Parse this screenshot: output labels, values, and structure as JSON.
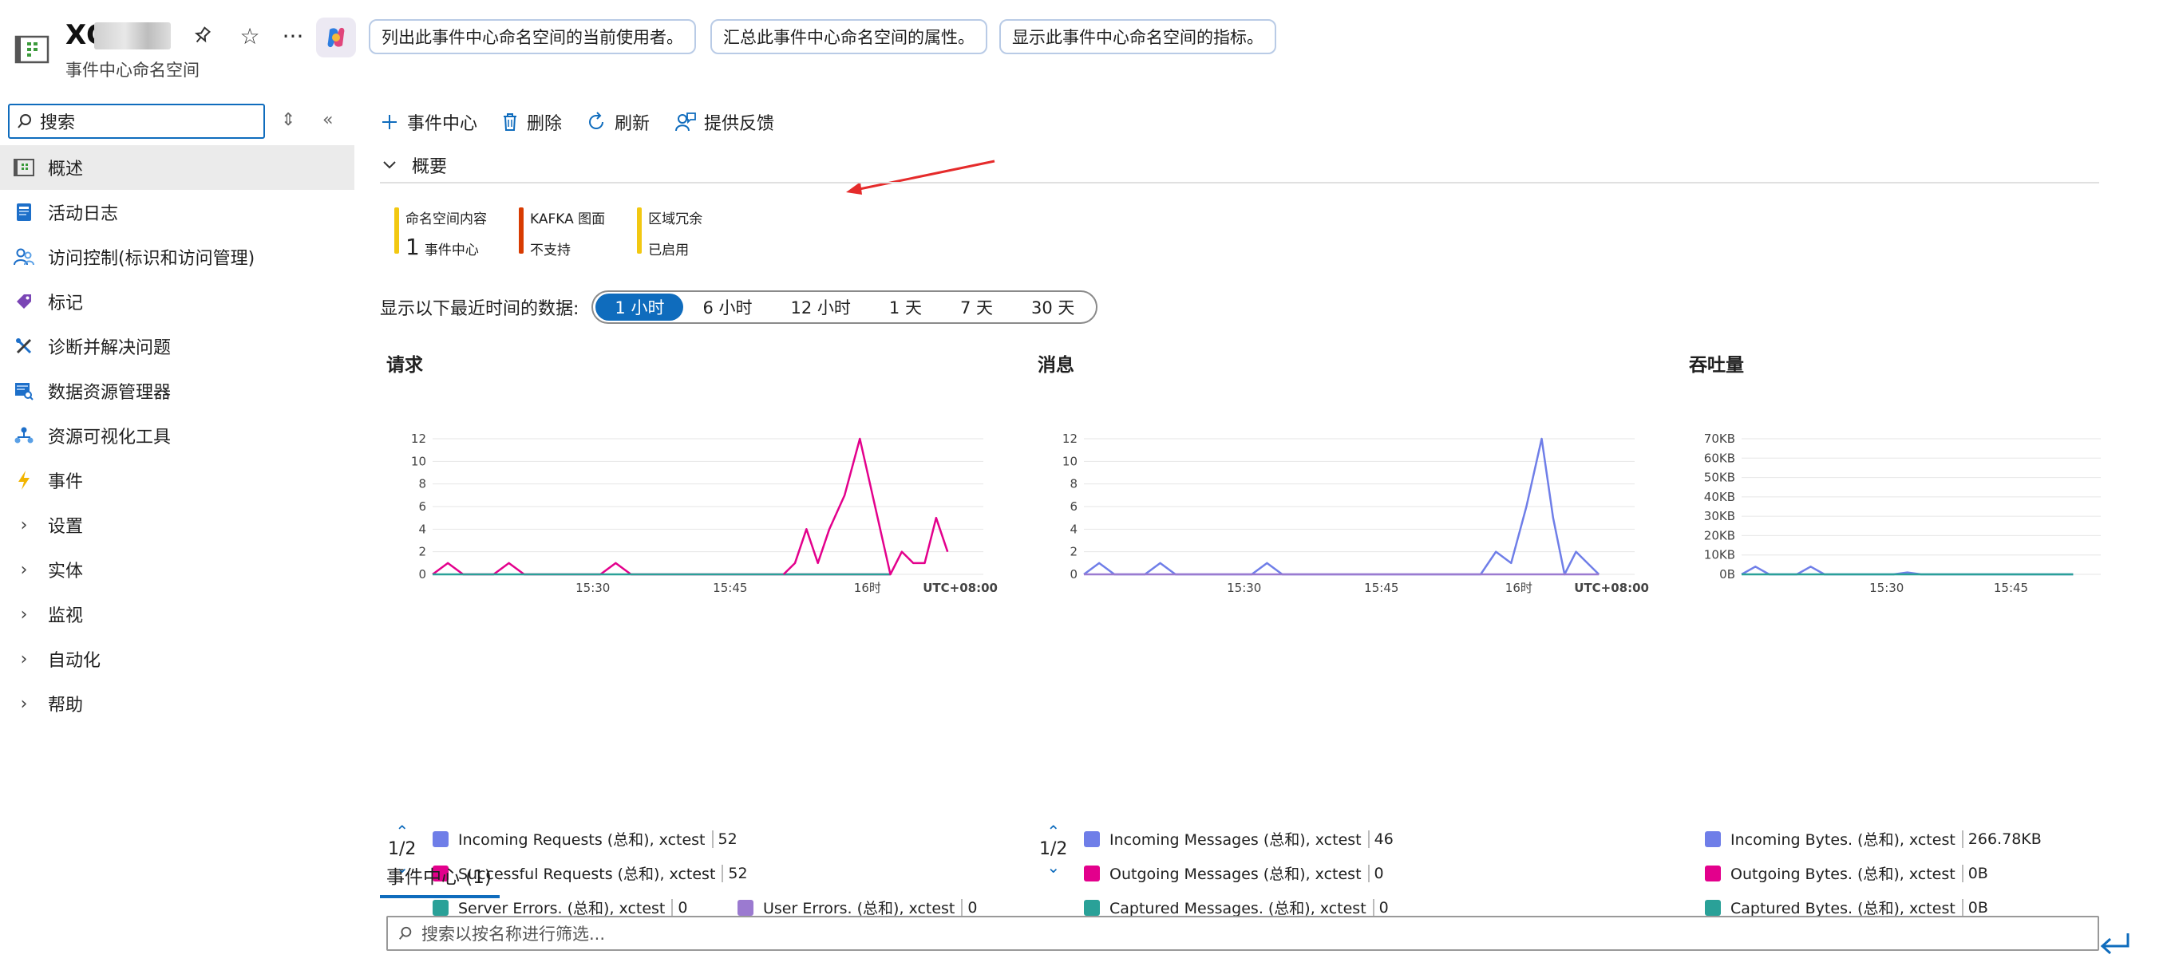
{
  "header": {
    "title": "XC",
    "subtitle": "事件中心命名空间",
    "chips": [
      "列出此事件中心命名空间的当前使用者。",
      "汇总此事件中心命名空间的属性。",
      "显示此事件中心命名空间的指标。"
    ],
    "icons": [
      "pin-icon",
      "star-icon",
      "more-icon",
      "copilot-icon"
    ]
  },
  "sidebar": {
    "search_placeholder": "搜索",
    "items": [
      {
        "label": "概述",
        "icon": "overview-icon",
        "active": true
      },
      {
        "label": "活动日志",
        "icon": "activity-log-icon"
      },
      {
        "label": "访问控制(标识和访问管理)",
        "icon": "people-icon"
      },
      {
        "label": "标记",
        "icon": "tag-icon"
      },
      {
        "label": "诊断并解决问题",
        "icon": "wrench-icon"
      },
      {
        "label": "数据资源管理器",
        "icon": "data-explorer-icon"
      },
      {
        "label": "资源可视化工具",
        "icon": "visualizer-icon"
      },
      {
        "label": "事件",
        "icon": "lightning-icon"
      },
      {
        "label": "设置",
        "expandable": true
      },
      {
        "label": "实体",
        "expandable": true
      },
      {
        "label": "监视",
        "expandable": true
      },
      {
        "label": "自动化",
        "expandable": true
      },
      {
        "label": "帮助",
        "expandable": true
      }
    ]
  },
  "toolbar": {
    "add_event_hub": "事件中心",
    "delete": "删除",
    "refresh": "刷新",
    "feedback": "提供反馈"
  },
  "essentials": {
    "title": "概要",
    "cards": [
      {
        "label": "命名空间内容",
        "value_big": "1",
        "value": "事件中心",
        "color": "#f2c811"
      },
      {
        "label": "KAFKA 图面",
        "value_big": "",
        "value": "不支持",
        "color": "#d83b01"
      },
      {
        "label": "区域冗余",
        "value_big": "",
        "value": "已启用",
        "color": "#f2c811"
      }
    ]
  },
  "time_range": {
    "label": "显示以下最近时间的数据:",
    "options": [
      "1 小时",
      "6 小时",
      "12 小时",
      "1 天",
      "7 天",
      "30 天"
    ],
    "selected": 0
  },
  "charts_meta": {
    "requests": {
      "title": "请求",
      "pager": "1/2",
      "legend": [
        {
          "name": "Incoming Requests (总和), xctest",
          "value": "52",
          "color": "#6f7ee8"
        },
        {
          "name": "Successful Requests (总和), xctest",
          "value": "52",
          "color": "#e3008c"
        },
        {
          "name": "Server Errors. (总和), xctest",
          "value": "0",
          "color": "#2aa198"
        },
        {
          "name": "User Errors. (总和), xctest",
          "value": "0",
          "color": "#9b7ad0"
        }
      ]
    },
    "messages": {
      "title": "消息",
      "pager": "1/2",
      "legend": [
        {
          "name": "Incoming Messages (总和), xctest",
          "value": "46",
          "color": "#6f7ee8"
        },
        {
          "name": "Outgoing Messages (总和), xctest",
          "value": "0",
          "color": "#e3008c"
        },
        {
          "name": "Captured Messages. (总和), xctest",
          "value": "0",
          "color": "#2aa198"
        }
      ]
    },
    "throughput": {
      "title": "吞吐量",
      "legend": [
        {
          "name": "Incoming Bytes. (总和), xctest",
          "value": "266.78KB",
          "color": "#6f7ee8"
        },
        {
          "name": "Outgoing Bytes. (总和), xctest",
          "value": "0B",
          "color": "#e3008c"
        },
        {
          "name": "Captured Bytes. (总和), xctest",
          "value": "0B",
          "color": "#2aa198"
        }
      ]
    }
  },
  "chart_data": [
    {
      "type": "line",
      "title": "请求",
      "x_ticks": [
        "15:30",
        "15:45",
        "16时",
        "UTC+08:00"
      ],
      "y_ticks": [
        0,
        2,
        4,
        6,
        8,
        10,
        12
      ],
      "ylim": [
        0,
        12
      ],
      "x_range": [
        0,
        60
      ],
      "series": [
        {
          "name": "Successful Requests (总和), xctest",
          "color": "#e3008c",
          "x": [
            0,
            2,
            4,
            6,
            8,
            10,
            12,
            14,
            16,
            18,
            20,
            22,
            24,
            26,
            28,
            30,
            32,
            34,
            36,
            38,
            40,
            42,
            44,
            46,
            48,
            50,
            52,
            54,
            56,
            58,
            60
          ],
          "y": [
            0,
            1,
            0,
            0,
            0,
            1,
            0,
            0,
            0,
            0,
            0,
            0,
            1,
            0,
            0,
            0,
            0,
            0,
            0,
            0,
            0,
            0,
            0,
            0,
            0,
            0,
            0,
            0,
            0,
            0,
            0
          ]
        },
        {
          "name": "Server Errors. (总和), xctest",
          "color": "#2aa198",
          "x": [
            0,
            60
          ],
          "y": [
            0,
            0
          ]
        }
      ],
      "tail_series": {
        "x": [
          46,
          47.5,
          49,
          50.5,
          52,
          54,
          56,
          58,
          60,
          61.5,
          63,
          64.5,
          66,
          67.5
        ],
        "y": [
          0,
          1,
          4,
          1,
          4,
          7,
          12,
          6,
          0,
          2,
          1,
          1,
          5,
          2
        ]
      }
    },
    {
      "type": "line",
      "title": "消息",
      "x_ticks": [
        "15:30",
        "15:45",
        "16时",
        "UTC+08:00"
      ],
      "y_ticks": [
        0,
        2,
        4,
        6,
        8,
        10,
        12
      ],
      "ylim": [
        0,
        12
      ],
      "series": [
        {
          "name": "Incoming Messages (总和), xctest",
          "color": "#6f7ee8",
          "x": [
            0,
            2,
            4,
            6,
            8,
            10,
            12,
            14,
            16,
            18,
            20,
            22,
            24,
            26,
            28,
            30,
            32,
            34,
            36,
            38,
            40,
            42,
            44,
            46,
            48,
            50,
            52,
            54,
            56,
            58,
            60,
            61.5,
            63,
            64.5,
            66,
            67.5
          ],
          "y": [
            0,
            1,
            0,
            0,
            0,
            1,
            0,
            0,
            0,
            0,
            0,
            0,
            1,
            0,
            0,
            0,
            0,
            0,
            0,
            0,
            0,
            0,
            0,
            0,
            0,
            0,
            0,
            2,
            1,
            6,
            12,
            5,
            0,
            2,
            1,
            0
          ]
        },
        {
          "name": "Captured Messages. (总和), xctest",
          "color": "#9b7ad0",
          "x": [
            0,
            67.5
          ],
          "y": [
            0,
            0
          ]
        }
      ]
    },
    {
      "type": "line",
      "title": "吞吐量",
      "x_ticks": [
        "15:30",
        "15:45"
      ],
      "y_ticks": [
        "0B",
        "10KB",
        "20KB",
        "30KB",
        "40KB",
        "50KB",
        "60KB",
        "70KB"
      ],
      "ylim": [
        0,
        70
      ],
      "series": [
        {
          "name": "Incoming Bytes. (总和), xctest",
          "color": "#6f7ee8",
          "x": [
            0,
            2,
            4,
            6,
            8,
            10,
            12,
            14,
            16,
            18,
            20,
            22,
            24,
            26,
            28,
            30,
            32,
            34,
            36,
            38,
            40,
            42,
            44,
            46,
            48
          ],
          "y": [
            0,
            4,
            0,
            0,
            0,
            4,
            0,
            0,
            0,
            0,
            0,
            0,
            1,
            0,
            0,
            0,
            0,
            0,
            0,
            0,
            0,
            0,
            0,
            0,
            0
          ]
        },
        {
          "name": "Captured Bytes. (总和), xctest",
          "color": "#2aa198",
          "x": [
            0,
            48
          ],
          "y": [
            0,
            0
          ]
        }
      ]
    }
  ],
  "event_hubs": {
    "tab_label": "事件中心 (1)",
    "filter_placeholder": "搜索以按名称进行筛选..."
  }
}
